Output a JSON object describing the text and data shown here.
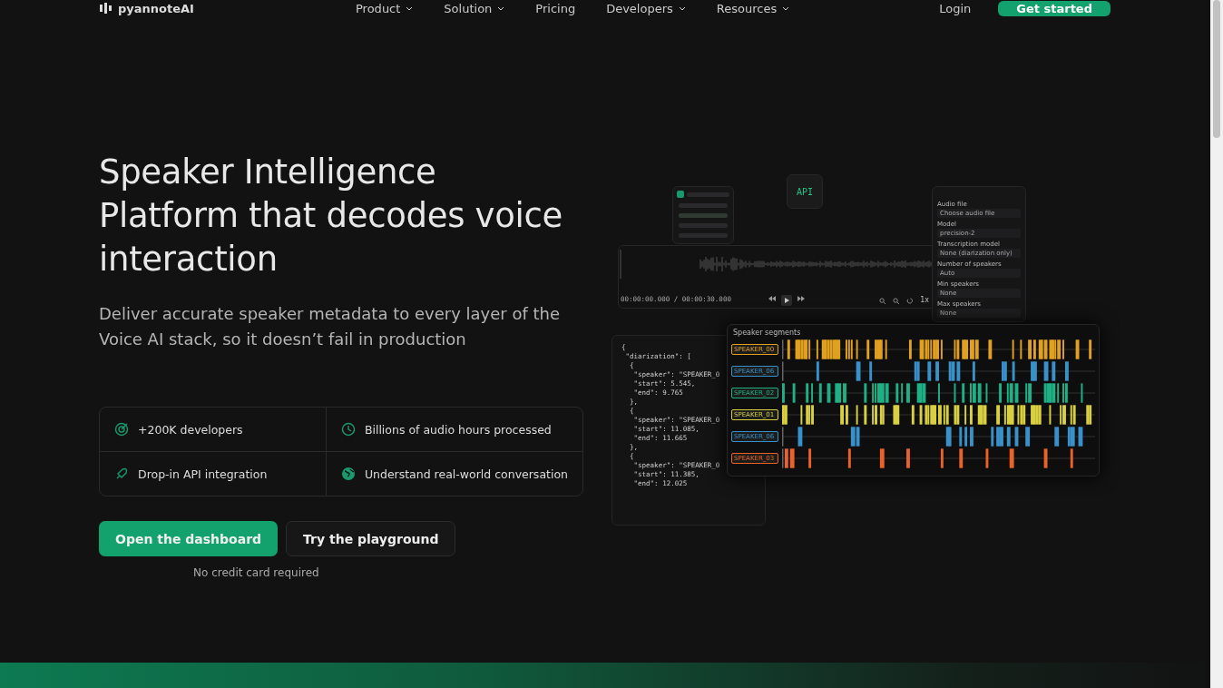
{
  "nav": {
    "logo": "pyannoteAI",
    "links": [
      {
        "label": "Product",
        "has_menu": true
      },
      {
        "label": "Solution",
        "has_menu": true
      },
      {
        "label": "Pricing",
        "has_menu": false
      },
      {
        "label": "Developers",
        "has_menu": true
      },
      {
        "label": "Resources",
        "has_menu": true
      }
    ],
    "login": "Login",
    "cta": "Get started"
  },
  "hero": {
    "title": "Speaker Intelligence Platform that decodes voice interaction",
    "subtitle": "Deliver accurate speaker metadata to every layer of the Voice AI stack, so it doesn’t fail in production",
    "features": [
      "+200K developers",
      "Billions of audio hours processed",
      "Drop-in API integration",
      "Understand real-world conversation"
    ],
    "primary_button": "Open the dashboard",
    "secondary_button": "Try the playground",
    "note": "No credit card required"
  },
  "illustration": {
    "api_badge": "API",
    "time": "00:00:00.000 / 00:00:30.000",
    "speed": "1x",
    "settings": [
      {
        "label": "Audio file",
        "value": "Choose audio file"
      },
      {
        "label": "Model",
        "value": "precision-2"
      },
      {
        "label": "Transcription model",
        "value": "None (diarization only)"
      },
      {
        "label": "Number of speakers",
        "value": "Auto"
      },
      {
        "label": "Min speakers",
        "value": "None"
      },
      {
        "label": "Max speakers",
        "value": "None"
      }
    ],
    "code_lines": [
      "{",
      " \"diarization\": [",
      "  {",
      "   \"speaker\": \"SPEAKER_0",
      "   \"start\": 5.545,",
      "   \"end\": 9.765",
      "  },",
      "  {",
      "   \"speaker\": \"SPEAKER_0",
      "   \"start\": 11.085,",
      "   \"end\": 11.665",
      "  },",
      "  {",
      "   \"speaker\": \"SPEAKER_0",
      "   \"start\": 11.385,",
      "   \"end\": 12.025"
    ],
    "segments": {
      "title": "Speaker segments",
      "speakers": [
        {
          "label": "SPEAKER_00",
          "color": "#e0a020"
        },
        {
          "label": "SPEAKER_06",
          "color": "#3a90c8"
        },
        {
          "label": "SPEAKER_02",
          "color": "#1fb086"
        },
        {
          "label": "SPEAKER_01",
          "color": "#d8d040"
        },
        {
          "label": "SPEAKER_06",
          "color": "#3a90c8"
        },
        {
          "label": "SPEAKER_03",
          "color": "#e8622a"
        }
      ]
    }
  }
}
